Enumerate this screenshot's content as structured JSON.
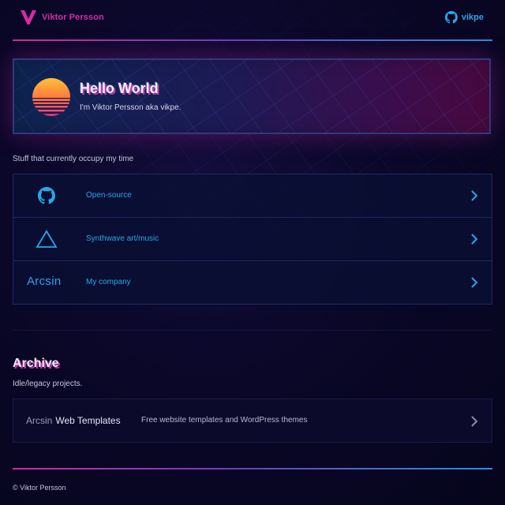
{
  "header": {
    "site_name": "Viktor Persson",
    "github_label": "vikpe"
  },
  "hero": {
    "title": "Hello World",
    "subtitle": "I'm Viktor Persson aka vikpe."
  },
  "section": {
    "label": "Stuff that currently occupy my time"
  },
  "items": [
    {
      "label": "Open-source",
      "icon": "github-icon"
    },
    {
      "label": "Synthwave art/music",
      "icon": "triangle-icon"
    },
    {
      "label": "My company",
      "logo_text": "Arcsin"
    }
  ],
  "archive": {
    "title": "Archive",
    "subtitle": "Idle/legacy projects.",
    "card": {
      "logo_light": "Arcsin",
      "logo_bold": "Web Templates",
      "description": "Free website templates and WordPress themes"
    }
  },
  "footer": {
    "text": "© Viktor Persson"
  },
  "colors": {
    "accent_pink": "#d62aa8",
    "accent_blue": "#27a7e6",
    "background": "#07051f"
  }
}
